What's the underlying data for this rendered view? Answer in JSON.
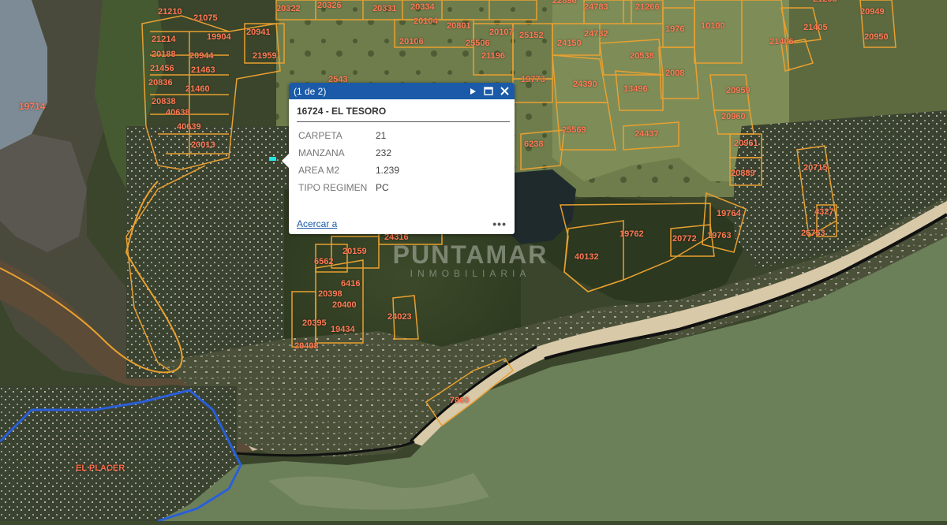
{
  "map": {
    "place_label": "EL PLACER",
    "colors": {
      "parcel_outline": "#e8a030",
      "parcel_label": "#ff7a55",
      "district_outline": "#2a5fd8",
      "ocean": "#6b7f59",
      "beach": "#d8c9a8"
    },
    "parcel_labels": [
      "20322",
      "20326",
      "20331",
      "20334",
      "22896",
      "24783",
      "21266",
      "21205",
      "20949",
      "21210",
      "21075",
      "20104",
      "20801",
      "20107",
      "25152",
      "24782",
      "1976",
      "10100",
      "21405",
      "21406",
      "20950",
      "21214",
      "19904",
      "20941",
      "20106",
      "25506",
      "24150",
      "20538",
      "20188",
      "20944",
      "21959",
      "21196",
      "21456",
      "21463",
      "2008",
      "19773",
      "20836",
      "21460",
      "2543",
      "24390",
      "13496",
      "20959",
      "20838",
      "40638",
      "40639",
      "20960",
      "19714",
      "20013",
      "25569",
      "24437",
      "6238",
      "20961",
      "20889",
      "20715",
      "19764",
      "4327",
      "19762",
      "20772",
      "19763",
      "26753",
      "24316",
      "40132",
      "6562",
      "20159",
      "6416",
      "20398",
      "20400",
      "24023",
      "20395",
      "19434",
      "20408",
      "7860"
    ],
    "watermark": {
      "brand": "PUNTAMAR",
      "sub": "INMOBILIARIA"
    }
  },
  "popup": {
    "counter": "(1 de 2)",
    "title": "16724 - EL TESORO",
    "fields": [
      {
        "key": "CARPETA",
        "value": "21"
      },
      {
        "key": "MANZANA",
        "value": "232"
      },
      {
        "key": "AREA M2",
        "value": "1.239"
      },
      {
        "key": "TIPO REGIMEN",
        "value": "PC"
      }
    ],
    "zoom_link": "Acercar a",
    "more_label": "•••",
    "icons": {
      "next": "play-icon",
      "maximize": "maximize-icon",
      "close": "close-icon"
    }
  }
}
